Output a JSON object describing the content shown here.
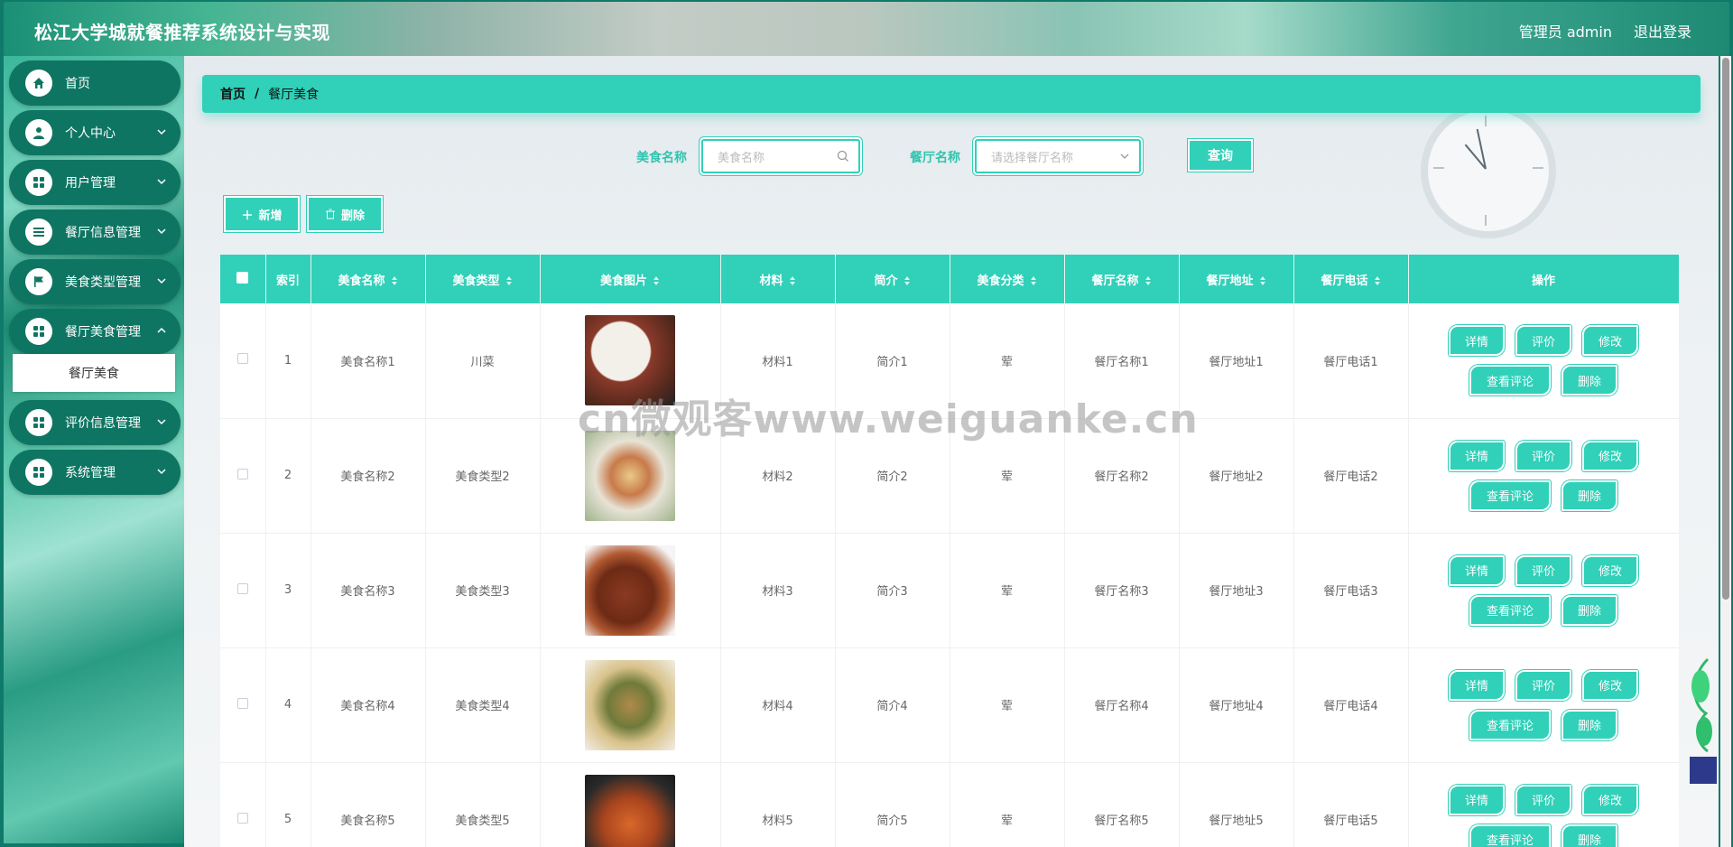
{
  "header": {
    "title": "松江大学城就餐推荐系统设计与实现",
    "user_label": "管理员 admin",
    "logout_label": "退出登录"
  },
  "sidebar": {
    "items": [
      {
        "label": "首页",
        "icon": "home-icon",
        "expandable": false
      },
      {
        "label": "个人中心",
        "icon": "user-icon",
        "expandable": true
      },
      {
        "label": "用户管理",
        "icon": "grid-icon",
        "expandable": true
      },
      {
        "label": "餐厅信息管理",
        "icon": "list-icon",
        "expandable": true
      },
      {
        "label": "美食类型管理",
        "icon": "flag-icon",
        "expandable": true
      },
      {
        "label": "餐厅美食管理",
        "icon": "grid-icon",
        "expandable": true
      },
      {
        "label": "评价信息管理",
        "icon": "grid-icon",
        "expandable": true
      },
      {
        "label": "系统管理",
        "icon": "grid-icon",
        "expandable": true
      }
    ],
    "active_submenu": "餐厅美食"
  },
  "breadcrumb": {
    "home": "首页",
    "separator": "/",
    "current": "餐厅美食"
  },
  "search": {
    "food_name_label": "美食名称",
    "food_name_placeholder": "美食名称",
    "restaurant_label": "餐厅名称",
    "restaurant_placeholder": "请选择餐厅名称",
    "query_label": "查询"
  },
  "actions": {
    "add_label": "新增",
    "delete_label": "删除"
  },
  "table": {
    "columns": [
      "索引",
      "美食名称",
      "美食类型",
      "美食图片",
      "材料",
      "简介",
      "美食分类",
      "餐厅名称",
      "餐厅地址",
      "餐厅电话",
      "操作"
    ],
    "rows": [
      {
        "index": "1",
        "name": "美食名称1",
        "type": "川菜",
        "material": "材料1",
        "intro": "简介1",
        "category": "荤",
        "restaurant": "餐厅名称1",
        "address": "餐厅地址1",
        "phone": "餐厅电话1"
      },
      {
        "index": "2",
        "name": "美食名称2",
        "type": "美食类型2",
        "material": "材料2",
        "intro": "简介2",
        "category": "荤",
        "restaurant": "餐厅名称2",
        "address": "餐厅地址2",
        "phone": "餐厅电话2"
      },
      {
        "index": "3",
        "name": "美食名称3",
        "type": "美食类型3",
        "material": "材料3",
        "intro": "简介3",
        "category": "荤",
        "restaurant": "餐厅名称3",
        "address": "餐厅地址3",
        "phone": "餐厅电话3"
      },
      {
        "index": "4",
        "name": "美食名称4",
        "type": "美食类型4",
        "material": "材料4",
        "intro": "简介4",
        "category": "荤",
        "restaurant": "餐厅名称4",
        "address": "餐厅地址4",
        "phone": "餐厅电话4"
      },
      {
        "index": "5",
        "name": "美食名称5",
        "type": "美食类型5",
        "material": "材料5",
        "intro": "简介5",
        "category": "荤",
        "restaurant": "餐厅名称5",
        "address": "餐厅地址5",
        "phone": "餐厅电话5"
      }
    ],
    "row_actions": {
      "detail": "详情",
      "rate": "评价",
      "edit": "修改",
      "view_comments": "查看评论",
      "delete": "删除"
    }
  },
  "watermark": "cn微观客www.weiguanke.cn",
  "colors": {
    "accent": "#31d0b8",
    "sidebar_item": "#0f7563"
  }
}
